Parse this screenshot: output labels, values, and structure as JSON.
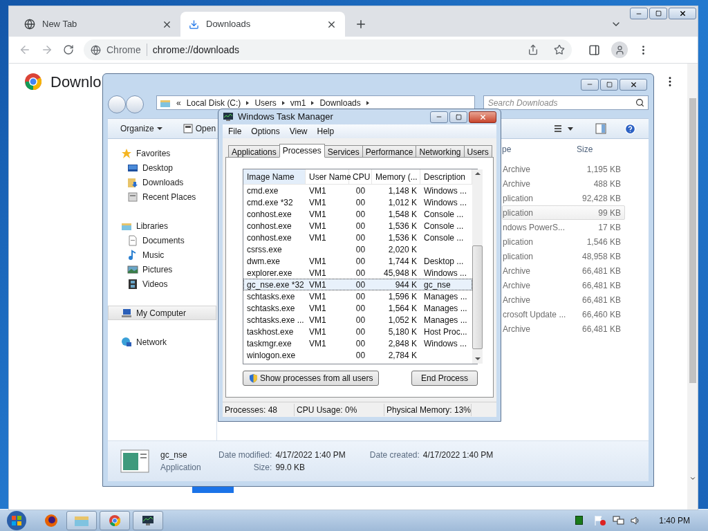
{
  "chrome": {
    "tabs": [
      {
        "title": "New Tab",
        "selected": false
      },
      {
        "title": "Downloads",
        "selected": true
      }
    ],
    "omnibox": {
      "chip": "Chrome",
      "url": "chrome://downloads"
    },
    "page_heading": "Downlo"
  },
  "explorer": {
    "breadcrumb_prefix": "«",
    "breadcrumb": [
      "Local Disk (C:)",
      "Users",
      "vm1",
      "Downloads"
    ],
    "search": {
      "placeholder": "Search Downloads"
    },
    "toolbar": [
      {
        "label": "Organize",
        "kind": "menu"
      },
      {
        "label": "Open",
        "kind": "button"
      }
    ],
    "nav": [
      {
        "label": "Favorites",
        "selected": false,
        "children": [
          {
            "label": "Desktop",
            "selected": false
          },
          {
            "label": "Downloads",
            "selected": false
          },
          {
            "label": "Recent Places",
            "selected": false
          }
        ]
      },
      {
        "label": "Libraries",
        "selected": false,
        "children": [
          {
            "label": "Documents",
            "selected": false
          },
          {
            "label": "Music",
            "selected": false
          },
          {
            "label": "Pictures",
            "selected": false
          },
          {
            "label": "Videos",
            "selected": false
          }
        ]
      },
      {
        "label": "My Computer",
        "selected": true
      },
      {
        "label": "Network",
        "selected": false
      }
    ],
    "file_list": {
      "columns": [
        "pe",
        "Size"
      ],
      "rows": [
        {
          "type": "Archive",
          "size": "1,195 KB",
          "selected": false
        },
        {
          "type": "Archive",
          "size": "488 KB",
          "selected": false
        },
        {
          "type": "plication",
          "size": "92,428 KB",
          "selected": false
        },
        {
          "type": "plication",
          "size": "99 KB",
          "selected": true
        },
        {
          "type": "ndows PowerS...",
          "size": "17 KB",
          "selected": false
        },
        {
          "type": "plication",
          "size": "1,546 KB",
          "selected": false
        },
        {
          "type": "plication",
          "size": "48,958 KB",
          "selected": false
        },
        {
          "type": "Archive",
          "size": "66,481 KB",
          "selected": false
        },
        {
          "type": "Archive",
          "size": "66,481 KB",
          "selected": false
        },
        {
          "type": "Archive",
          "size": "66,481 KB",
          "selected": false
        },
        {
          "type": "crosoft Update ...",
          "size": "66,460 KB",
          "selected": false
        },
        {
          "type": "Archive",
          "size": "66,481 KB",
          "selected": false
        }
      ]
    },
    "details": {
      "name": "gc_nse",
      "type": "Application",
      "fields": [
        {
          "label": "Date modified:",
          "value": "4/17/2022 1:40 PM"
        },
        {
          "label": "Size:",
          "value": "99.0 KB"
        },
        {
          "label": "Date created:",
          "value": "4/17/2022 1:40 PM"
        }
      ]
    }
  },
  "task_manager": {
    "title": "Windows Task Manager",
    "menu": [
      "File",
      "Options",
      "View",
      "Help"
    ],
    "tabs": [
      {
        "label": "Applications",
        "selected": false
      },
      {
        "label": "Processes",
        "selected": true
      },
      {
        "label": "Services",
        "selected": false
      },
      {
        "label": "Performance",
        "selected": false
      },
      {
        "label": "Networking",
        "selected": false
      },
      {
        "label": "Users",
        "selected": false
      }
    ],
    "columns": [
      "Image Name",
      "User Name",
      "CPU",
      "Memory (...",
      "Description"
    ],
    "rows": [
      {
        "image": "cmd.exe",
        "user": "VM1",
        "cpu": "00",
        "memory": "1,148 K",
        "description": "Windows ...",
        "selected": false
      },
      {
        "image": "cmd.exe *32",
        "user": "VM1",
        "cpu": "00",
        "memory": "1,012 K",
        "description": "Windows ...",
        "selected": false
      },
      {
        "image": "conhost.exe",
        "user": "VM1",
        "cpu": "00",
        "memory": "1,548 K",
        "description": "Console ...",
        "selected": false
      },
      {
        "image": "conhost.exe",
        "user": "VM1",
        "cpu": "00",
        "memory": "1,536 K",
        "description": "Console ...",
        "selected": false
      },
      {
        "image": "conhost.exe",
        "user": "VM1",
        "cpu": "00",
        "memory": "1,536 K",
        "description": "Console ...",
        "selected": false
      },
      {
        "image": "csrss.exe",
        "cpu": "00",
        "memory": "2,020 K",
        "selected": false
      },
      {
        "image": "dwm.exe",
        "user": "VM1",
        "cpu": "00",
        "memory": "1,744 K",
        "description": "Desktop ...",
        "selected": false
      },
      {
        "image": "explorer.exe",
        "user": "VM1",
        "cpu": "00",
        "memory": "45,948 K",
        "description": "Windows ...",
        "selected": false
      },
      {
        "image": "gc_nse.exe *32",
        "user": "VM1",
        "cpu": "00",
        "memory": "944 K",
        "description": "gc_nse",
        "selected": true
      },
      {
        "image": "schtasks.exe",
        "user": "VM1",
        "cpu": "00",
        "memory": "1,596 K",
        "description": "Manages ...",
        "selected": false
      },
      {
        "image": "schtasks.exe",
        "user": "VM1",
        "cpu": "00",
        "memory": "1,564 K",
        "description": "Manages ...",
        "selected": false
      },
      {
        "image": "schtasks.exe ...",
        "user": "VM1",
        "cpu": "00",
        "memory": "1,052 K",
        "description": "Manages ...",
        "selected": false
      },
      {
        "image": "taskhost.exe",
        "user": "VM1",
        "cpu": "00",
        "memory": "5,180 K",
        "description": "Host Proc...",
        "selected": false
      },
      {
        "image": "taskmgr.exe",
        "user": "VM1",
        "cpu": "00",
        "memory": "2,848 K",
        "description": "Windows ...",
        "selected": false
      },
      {
        "image": "winlogon.exe",
        "cpu": "00",
        "memory": "2,784 K",
        "selected": false
      }
    ],
    "buttons": [
      "Show processes from all users",
      "End Process"
    ],
    "status": [
      "Processes: 48",
      "CPU Usage: 0%",
      "Physical Memory: 13%"
    ]
  },
  "taskbar": {
    "clock": "1:40 PM"
  }
}
